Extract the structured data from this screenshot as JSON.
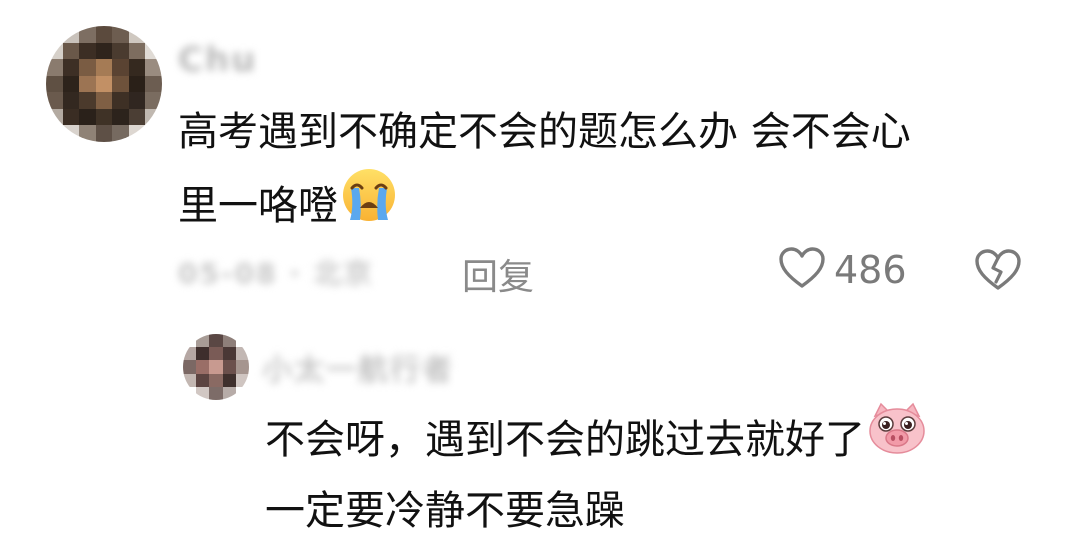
{
  "comment": {
    "username": "Chu",
    "line1": "高考遇到不确定不会的题怎么办 会不会心",
    "line2": "里一咯噔",
    "emoji": "crying-face-emoji",
    "date": "05-08 · 北京",
    "reply_label": "回复",
    "like_count": "486"
  },
  "reply": {
    "username": "小太一航行者",
    "line1": "不会呀，遇到不会的跳过去就好了",
    "line2": "一定要冷静不要急躁",
    "emoji": "pig-face-emoji"
  },
  "colors": {
    "text": "#111111",
    "meta": "#8a8a8a",
    "icon": "#7a7a7a"
  }
}
